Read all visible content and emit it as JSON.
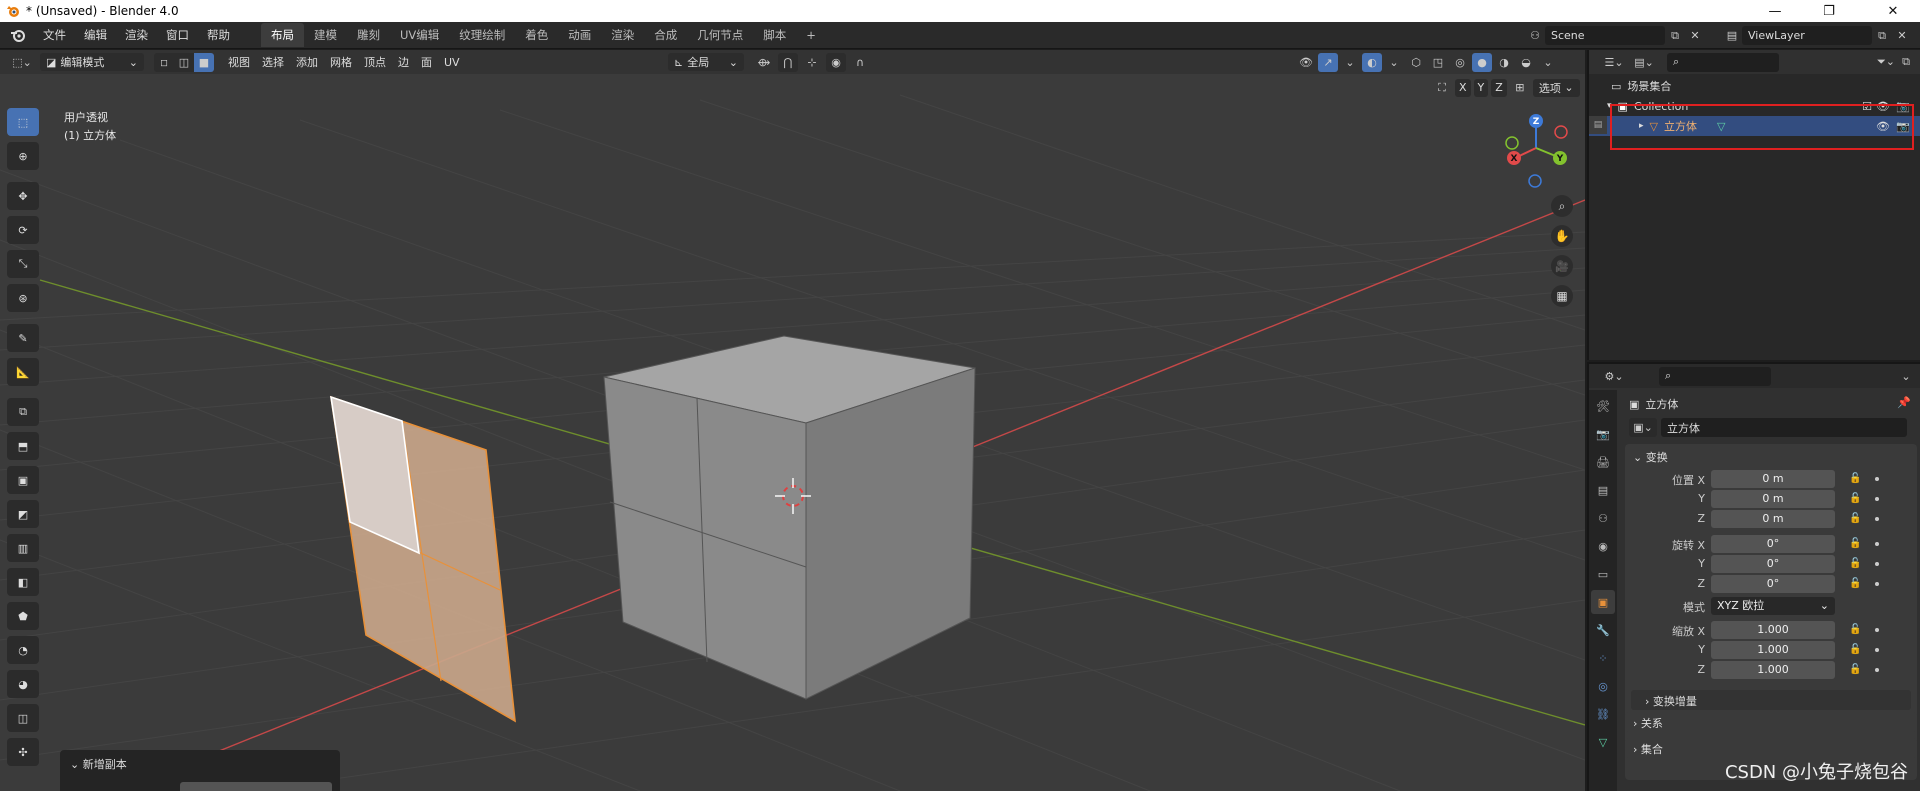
{
  "window": {
    "title": "* (Unsaved) - Blender 4.0",
    "minimize": "—",
    "maximize": "❐",
    "close": "✕"
  },
  "topbar": {
    "menus": [
      "文件",
      "编辑",
      "渲染",
      "窗口",
      "帮助"
    ],
    "workspaces": [
      "布局",
      "建模",
      "雕刻",
      "UV编辑",
      "纹理绘制",
      "着色",
      "动画",
      "渲染",
      "合成",
      "几何节点",
      "脚本"
    ],
    "active_workspace": "布局",
    "add_tab": "+",
    "scene_name": "Scene",
    "view_layer_name": "ViewLayer"
  },
  "viewport_header": {
    "mode": "编辑模式",
    "menus": [
      "视图",
      "选择",
      "添加",
      "网格",
      "顶点",
      "边",
      "面",
      "UV"
    ],
    "transform_orientation": "全局",
    "axis_x": "X",
    "axis_y": "Y",
    "axis_z": "Z",
    "options": "选项"
  },
  "viewport": {
    "view_name": "用户透视",
    "object_label": "(1) 立方体",
    "gizmo_x": "X",
    "gizmo_y": "Y",
    "gizmo_z": "Z",
    "colors": {
      "background": "#3b3b3b",
      "grid": "#444444",
      "x_axis": "#c44848",
      "y_axis": "#6e8e2c",
      "selection": "#e8913a",
      "gizmo_x": "#e14a4a",
      "gizmo_y": "#83c22e",
      "gizmo_z": "#3d7ad8"
    }
  },
  "redo_panel": {
    "title": "新增副本"
  },
  "outliner": {
    "scene_collection": "场景集合",
    "collection": "Collection",
    "object": "立方体",
    "highlight_color": "#e02020"
  },
  "properties": {
    "object_name": "立方体",
    "data_name": "立方体",
    "transform_panel": "变换",
    "location_label": "位置 X",
    "location": [
      "0 m",
      "0 m",
      "0 m"
    ],
    "rotation_label": "旋转 X",
    "rotation": [
      "0°",
      "0°",
      "0°"
    ],
    "mode_label": "模式",
    "mode_value": "XYZ 欧拉",
    "scale_label": "缩放 X",
    "scale": [
      "1.000",
      "1.000",
      "1.000"
    ],
    "y_label": "Y",
    "z_label": "Z",
    "delta_panel": "变换增量",
    "relations_panel": "关系",
    "collections_panel": "集合"
  },
  "watermark": "CSDN @小兔子烧包谷"
}
